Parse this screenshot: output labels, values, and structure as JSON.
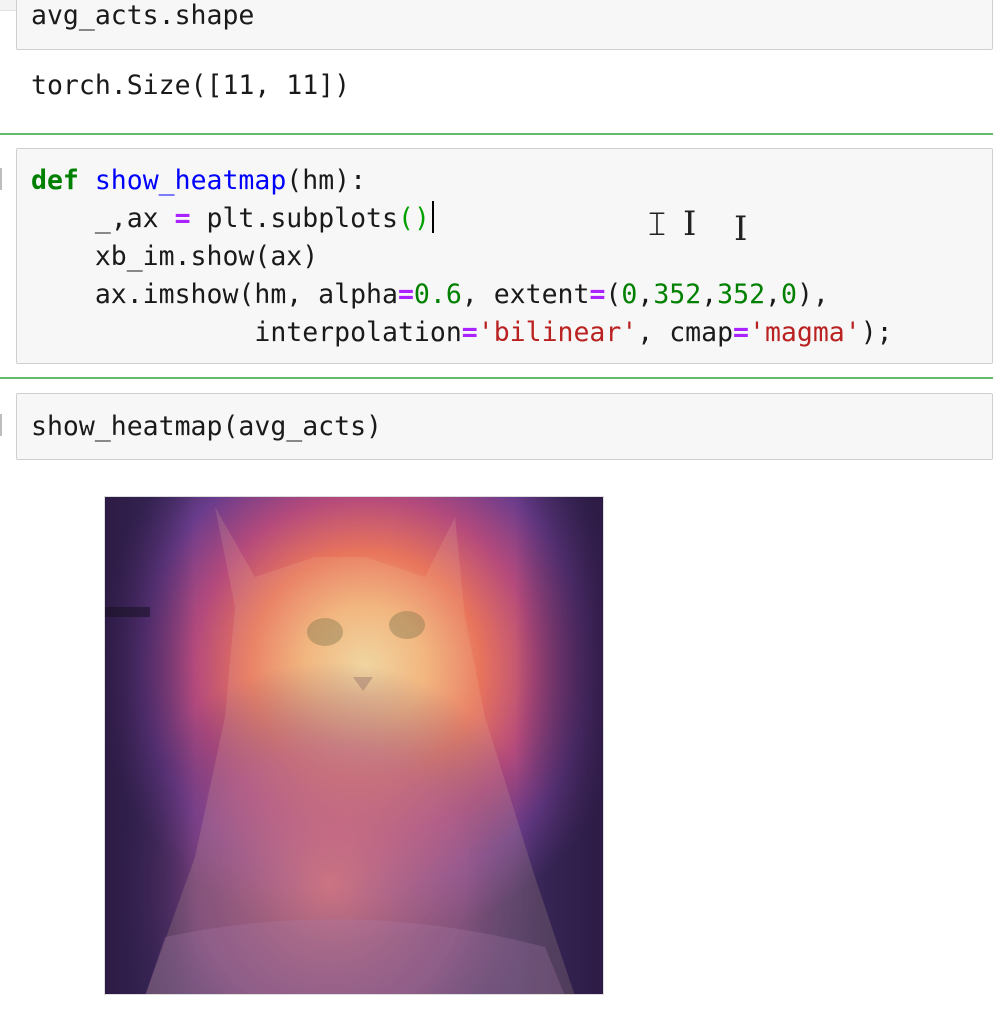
{
  "cells": [
    {
      "id": "cell-shape",
      "input_lines": [
        "avg_acts.shape"
      ],
      "output_lines": [
        "torch.Size([11, 11])"
      ]
    },
    {
      "id": "cell-def",
      "input_lines": [
        "def show_heatmap(hm):",
        "    _,ax = plt.subplots()",
        "    xb_im.show(ax)",
        "    ax.imshow(hm, alpha=0.6, extent=(0,352,352,0),",
        "              interpolation='bilinear', cmap='magma');"
      ]
    },
    {
      "id": "cell-call",
      "input_lines": [
        "show_heatmap(avg_acts)"
      ]
    }
  ],
  "output_image": {
    "icon": "heatmap-overlay-cat-image",
    "colormap": "magma",
    "alpha": 0.6
  },
  "colors": {
    "selected_border": "#66bb6a",
    "keyword": "#008000",
    "function_name": "#0000ff",
    "operator": "#aa22ff",
    "number": "#008000",
    "string": "#ba2121"
  },
  "mouse_cursors": [
    "text-cursor-icon",
    "text-cursor-icon",
    "text-cursor-icon"
  ]
}
